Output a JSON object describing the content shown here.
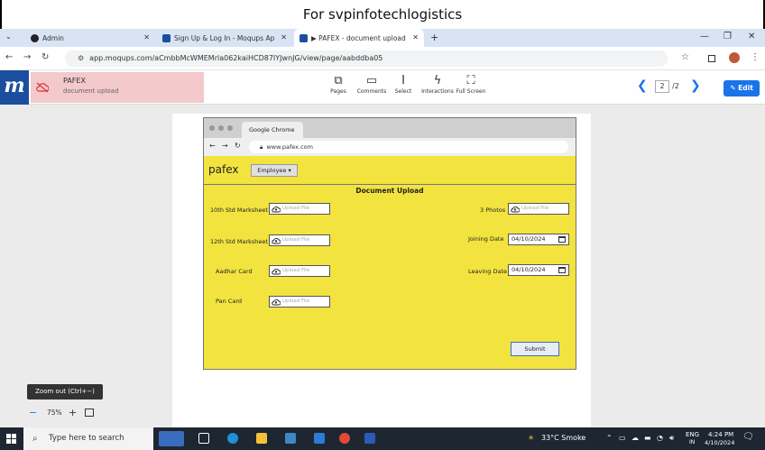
{
  "caption": "For svpinfotechlogistics",
  "browser": {
    "tabs": [
      {
        "label": "Admin",
        "active": false
      },
      {
        "label": "Sign Up & Log In - Moqups Ap",
        "active": false
      },
      {
        "label": "▶ PAFEX - document upload",
        "active": true
      }
    ],
    "new_tab": "+",
    "url": "app.moqups.com/aCmbbMcWMEMrla062kaiHCD87IYJwnJG/view/page/aabddba05"
  },
  "moqups": {
    "logo": "m",
    "project_name": "PAFEX",
    "page_name": "document upload",
    "tools": [
      "Pages",
      "Comments",
      "Select",
      "Interactions",
      "Full Screen"
    ],
    "page_current": "2",
    "page_total": "/2",
    "edit_label": "Edit"
  },
  "mock": {
    "tab_title": "Google Chrome",
    "url": "www.pafex.com",
    "brand": "pafex",
    "employee_btn": "Employee ▾",
    "title": "Document Upload",
    "upload_placeholder": "Upload File",
    "left_fields": [
      "10th Std Marksheet",
      "12th Std Marksheet",
      "Aadhar Card",
      "Pan Card"
    ],
    "right_fields": {
      "photos": "3 Photos",
      "joining": "Joining Date",
      "leaving": "Leaving Date"
    },
    "joining_value": "04/10/2024",
    "leaving_value": "04/10/2024",
    "submit": "Submit",
    "accent": "#f2e33f"
  },
  "zoom": {
    "tooltip": "Zoom out (Ctrl+−)",
    "minus": "−",
    "value": "75%",
    "plus": "+"
  },
  "taskbar": {
    "search_placeholder": "Type here to search",
    "weather": "33°C  Smoke",
    "lang": "ENG",
    "region": "IN",
    "time": "4:24 PM",
    "date": "4/10/2024"
  }
}
